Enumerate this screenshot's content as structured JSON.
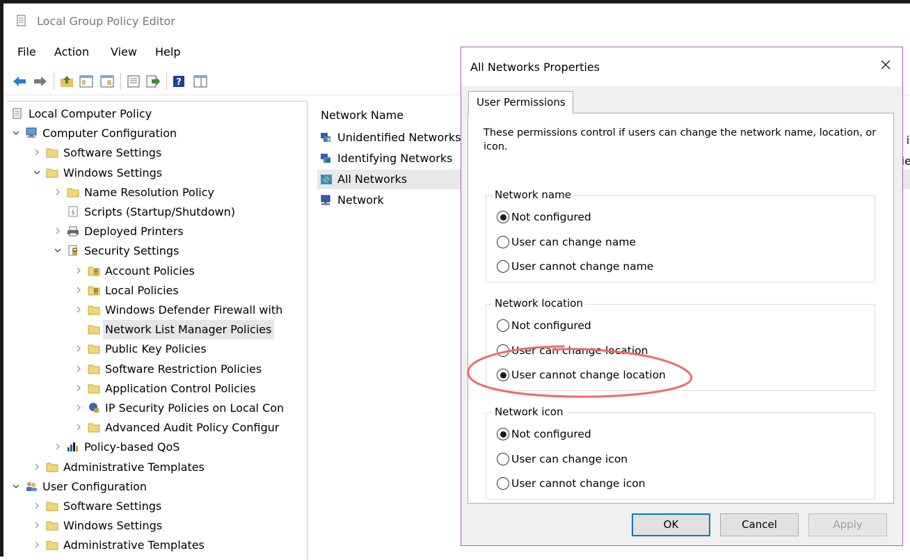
{
  "window": {
    "title": "Local Group Policy Editor",
    "icon": "policy-editor-icon"
  },
  "menu": [
    "File",
    "Action",
    "View",
    "Help"
  ],
  "toolbar": [
    "back-arrow-icon",
    "forward-arrow-icon",
    "up-folder-icon",
    "show-hide-tree-icon",
    "properties-icon",
    "export-list-icon",
    "help-icon",
    "console-tree-icon"
  ],
  "tree": [
    {
      "label": "Local Computer Policy",
      "icon": "policy-icon"
    },
    {
      "label": "Computer Configuration",
      "icon": "computer-icon"
    },
    {
      "label": "Software Settings",
      "icon": "folder-icon"
    },
    {
      "label": "Windows Settings",
      "icon": "folder-icon"
    },
    {
      "label": "Name Resolution Policy",
      "icon": "folder-icon"
    },
    {
      "label": "Scripts (Startup/Shutdown)",
      "icon": "script-icon"
    },
    {
      "label": "Deployed Printers",
      "icon": "printer-icon"
    },
    {
      "label": "Security Settings",
      "icon": "security-icon"
    },
    {
      "label": "Account Policies",
      "icon": "lock-folder-icon"
    },
    {
      "label": "Local Policies",
      "icon": "lock-folder-icon"
    },
    {
      "label": "Windows Defender Firewall with",
      "icon": "folder-icon"
    },
    {
      "label": "Network List Manager Policies",
      "icon": "folder-icon"
    },
    {
      "label": "Public Key Policies",
      "icon": "folder-icon"
    },
    {
      "label": "Software Restriction Policies",
      "icon": "folder-icon"
    },
    {
      "label": "Application Control Policies",
      "icon": "folder-icon"
    },
    {
      "label": "IP Security Policies on Local Con",
      "icon": "ipsec-icon"
    },
    {
      "label": "Advanced Audit Policy Configur",
      "icon": "folder-icon"
    },
    {
      "label": "Policy-based QoS",
      "icon": "bar-chart-icon"
    },
    {
      "label": "Administrative Templates",
      "icon": "folder-icon"
    },
    {
      "label": "User Configuration",
      "icon": "users-icon"
    },
    {
      "label": "Software Settings",
      "icon": "folder-icon"
    },
    {
      "label": "Windows Settings",
      "icon": "folder-icon"
    },
    {
      "label": "Administrative Templates",
      "icon": "folder-icon"
    }
  ],
  "list": {
    "column": "Network Name",
    "items": [
      {
        "label": "Unidentified Networks",
        "icon": "unidentified-network-icon"
      },
      {
        "label": "Identifying Networks",
        "icon": "identifying-network-icon"
      },
      {
        "label": "All Networks",
        "icon": "all-networks-icon"
      },
      {
        "label": "Network",
        "icon": "network-icon"
      }
    ],
    "edge_fragments": [
      "f i",
      "fie"
    ]
  },
  "dialog": {
    "title": "All Networks Properties",
    "tab": "User Permissions",
    "description": "These permissions control if users can change the network name, location, or icon.",
    "groups": [
      {
        "label": "Network name",
        "options": [
          "Not configured",
          "User can change name",
          "User cannot change name"
        ],
        "selected": 0
      },
      {
        "label": "Network location",
        "options": [
          "Not configured",
          "User can change location",
          "User cannot change location"
        ],
        "selected": 2
      },
      {
        "label": "Network icon",
        "options": [
          "Not configured",
          "User can change icon",
          "User cannot change icon"
        ],
        "selected": 0
      }
    ],
    "buttons": {
      "ok": "OK",
      "cancel": "Cancel",
      "apply": "Apply"
    }
  },
  "colors": {
    "annotation": "#f06a6a",
    "dialog_border": "#a25fb4",
    "default_button": "#0078d7"
  }
}
